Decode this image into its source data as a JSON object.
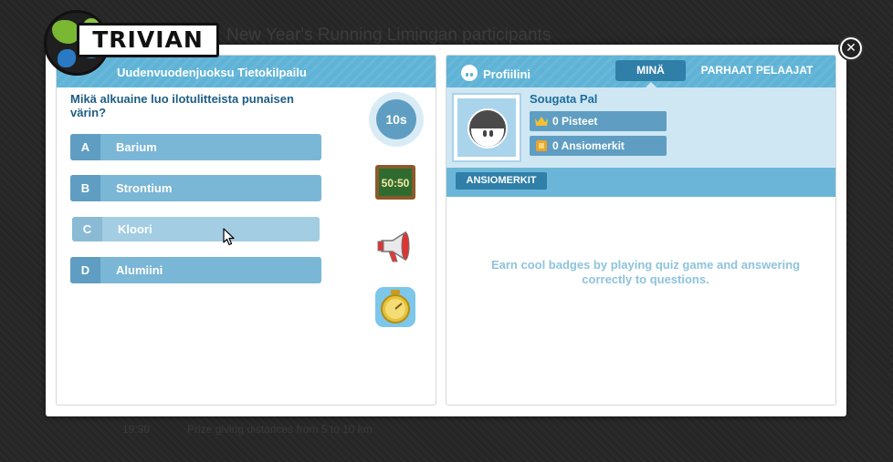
{
  "background": {
    "title": "New Year's Running Limingan participants",
    "footer_time": "19:30",
    "footer_note": "Prize giving distances from 5 to 10 km"
  },
  "logo": {
    "text": "TRIVIAN"
  },
  "quiz": {
    "header": "Uudenvuodenjuoksu Tietokilpailu",
    "question": "Mikä alkuaine luo ilotulitteista punaisen värin?",
    "answers": [
      {
        "letter": "A",
        "label": "Barium"
      },
      {
        "letter": "B",
        "label": "Strontium"
      },
      {
        "letter": "C",
        "label": "Kloori"
      },
      {
        "letter": "D",
        "label": "Alumiini"
      }
    ],
    "timer": "10s",
    "fifty_fifty_label": "50:50",
    "icons": [
      "fifty-fifty-icon",
      "megaphone-icon",
      "stopwatch-icon"
    ]
  },
  "profile": {
    "header": "Profiilini",
    "tabs": {
      "mine": "MINÄ",
      "top": "PARHAAT PELAAJAT"
    },
    "player_name": "Sougata Pal",
    "points": "0 Pisteet",
    "badges": "0 Ansiomerkit",
    "badge_button": "ANSIOMERKIT",
    "badge_message": "Earn cool badges by playing quiz game and answering correctly to questions."
  },
  "colors": {
    "accent": "#5eb3d6",
    "answer": "#7ab6d6",
    "answer_letter": "#5f9ec2",
    "active_tab": "#2f7fa8",
    "text_dark_blue": "#1d5d85"
  }
}
